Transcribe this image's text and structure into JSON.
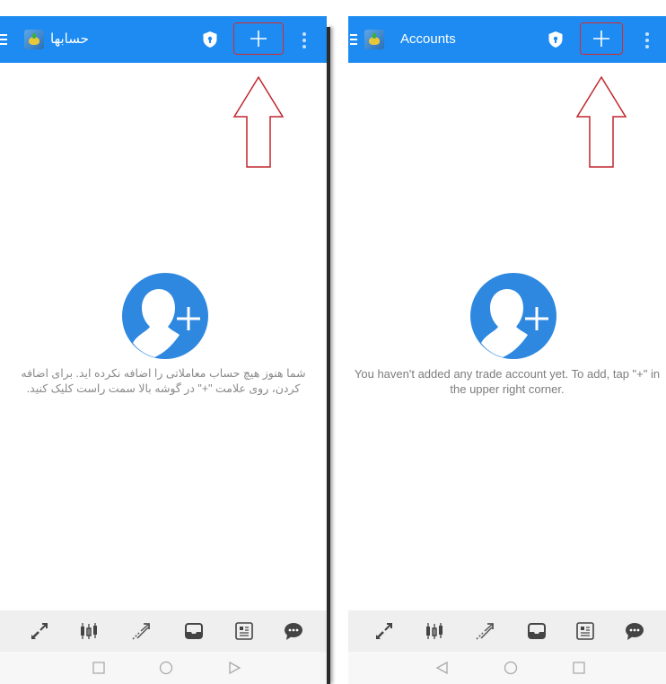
{
  "screens": [
    {
      "id": "farsi",
      "title": "حسابها",
      "message": "شما هنوز هیچ حساب معاملاتی را اضافه نکرده اید. برای اضافه کردن، روی علامت \"+\" در گوشه بالا سمت راست کلیک کنید.",
      "system_nav": [
        "square-icon",
        "circle-icon",
        "triangle-right-icon"
      ]
    },
    {
      "id": "english",
      "title": "Accounts",
      "message": "You haven't added any trade account yet. To add, tap \"+\" in the upper right corner.",
      "system_nav": [
        "triangle-left-icon",
        "circle-icon",
        "square-icon"
      ]
    }
  ],
  "bottom_nav_icons": [
    "quotes-icon",
    "chart-icon",
    "trade-icon",
    "history-icon",
    "news-icon",
    "chat-icon"
  ],
  "colors": {
    "toolbar": "#1d8bf1",
    "highlight": "#d62c2c",
    "message_text": "#8a8a8a",
    "nav_bg": "#efefef"
  }
}
